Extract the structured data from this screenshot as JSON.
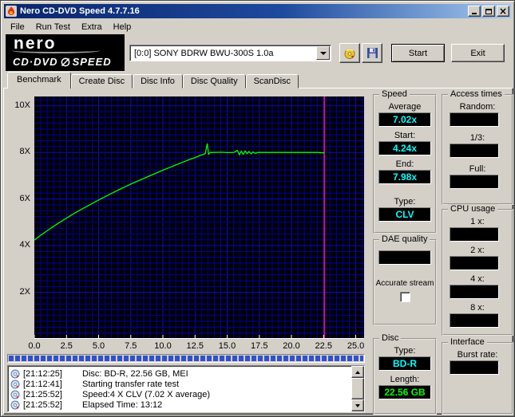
{
  "window": {
    "title": "Nero CD-DVD Speed 4.7.7.16"
  },
  "menu": {
    "items": [
      "File",
      "Run Test",
      "Extra",
      "Help"
    ]
  },
  "logo": {
    "brand": "nero",
    "product_line1": "CD·DVD",
    "product_line2": "SPEED"
  },
  "toolbar": {
    "drive_selector": {
      "value": "[0:0]  SONY BDRW BWU-300S 1.0a"
    },
    "buttons": [
      {
        "icon": "disc-icon"
      },
      {
        "icon": "save-icon"
      }
    ],
    "start_label": "Start",
    "exit_label": "Exit"
  },
  "tabs": [
    {
      "label": "Benchmark",
      "active": true
    },
    {
      "label": "Create Disc"
    },
    {
      "label": "Disc Info"
    },
    {
      "label": "Disc Quality"
    },
    {
      "label": "ScanDisc"
    }
  ],
  "chart_data": {
    "type": "line",
    "xlabel": "",
    "ylabel": "",
    "xlim": [
      0,
      25.65
    ],
    "ylim": [
      0,
      10.4
    ],
    "grid": {
      "x_step": 0.5,
      "y_step": 0.25,
      "x_major": 2.5,
      "y_major": 2
    },
    "x_ticks": [
      {
        "v": 0,
        "label": "0.0"
      },
      {
        "v": 2.5,
        "label": "2.5"
      },
      {
        "v": 5,
        "label": "5.0"
      },
      {
        "v": 7.5,
        "label": "7.5"
      },
      {
        "v": 10,
        "label": "10.0"
      },
      {
        "v": 12.5,
        "label": "12.5"
      },
      {
        "v": 15,
        "label": "15.0"
      },
      {
        "v": 17.5,
        "label": "17.5"
      },
      {
        "v": 20,
        "label": "20.0"
      },
      {
        "v": 22.5,
        "label": "22.5"
      },
      {
        "v": 25,
        "label": "25.0"
      }
    ],
    "y_ticks": [
      {
        "v": 2,
        "label": "2X"
      },
      {
        "v": 4,
        "label": "4X"
      },
      {
        "v": 6,
        "label": "6X"
      },
      {
        "v": 8,
        "label": "8X"
      },
      {
        "v": 10,
        "label": "10X"
      }
    ],
    "series": [
      {
        "name": "transfer-rate",
        "color": "#00ff00",
        "points": [
          [
            0,
            4.24
          ],
          [
            0.5,
            4.45
          ],
          [
            1,
            4.64
          ],
          [
            1.5,
            4.83
          ],
          [
            2,
            5.01
          ],
          [
            2.5,
            5.18
          ],
          [
            3,
            5.35
          ],
          [
            3.5,
            5.51
          ],
          [
            4,
            5.66
          ],
          [
            4.5,
            5.81
          ],
          [
            5,
            5.96
          ],
          [
            5.5,
            6.1
          ],
          [
            6,
            6.24
          ],
          [
            6.5,
            6.38
          ],
          [
            7,
            6.51
          ],
          [
            7.5,
            6.64
          ],
          [
            8,
            6.76
          ],
          [
            8.5,
            6.88
          ],
          [
            9,
            7.0
          ],
          [
            9.5,
            7.12
          ],
          [
            10,
            7.24
          ],
          [
            10.5,
            7.35
          ],
          [
            11,
            7.46
          ],
          [
            11.5,
            7.57
          ],
          [
            12,
            7.68
          ],
          [
            12.5,
            7.78
          ],
          [
            13,
            7.89
          ],
          [
            13.3,
            7.95
          ],
          [
            13.45,
            8.38
          ],
          [
            13.55,
            7.92
          ],
          [
            13.7,
            8.0
          ],
          [
            14,
            8.0
          ],
          [
            14.5,
            8.01
          ],
          [
            15,
            7.99
          ],
          [
            15.5,
            8.0
          ],
          [
            15.8,
            8.08
          ],
          [
            15.95,
            7.9
          ],
          [
            16.1,
            8.05
          ],
          [
            16.25,
            7.92
          ],
          [
            16.4,
            8.06
          ],
          [
            16.55,
            7.95
          ],
          [
            16.7,
            8.04
          ],
          [
            16.85,
            7.94
          ],
          [
            17,
            8.02
          ],
          [
            17.2,
            7.96
          ],
          [
            17.4,
            8.0
          ],
          [
            18,
            8.0
          ],
          [
            19,
            8.0
          ],
          [
            20,
            8.0
          ],
          [
            21,
            8.0
          ],
          [
            22,
            8.0
          ],
          [
            22.56,
            7.98
          ]
        ]
      }
    ],
    "marker_line": {
      "x": 22.56,
      "color": "#ff00aa"
    },
    "stats": {
      "average": "7.02x",
      "start": "4.24x",
      "end": "7.98x",
      "type": "CLV"
    }
  },
  "progress": {
    "percent": 100
  },
  "panels": {
    "speed": {
      "title": "Speed",
      "rows": [
        {
          "label": "Average",
          "value": "7.02x"
        },
        {
          "label": "Start:",
          "value": "4.24x"
        },
        {
          "label": "End:",
          "value": "7.98x"
        },
        {
          "label": "Type:",
          "value": "CLV"
        }
      ]
    },
    "access_times": {
      "title": "Access times",
      "rows": [
        {
          "label": "Random:",
          "value": ""
        },
        {
          "label": "1/3:",
          "value": ""
        },
        {
          "label": "Full:",
          "value": ""
        }
      ]
    },
    "cpu_usage": {
      "title": "CPU usage",
      "rows": [
        {
          "label": "1 x:",
          "value": ""
        },
        {
          "label": "2 x:",
          "value": ""
        },
        {
          "label": "4 x:",
          "value": ""
        },
        {
          "label": "8 x:",
          "value": ""
        }
      ]
    },
    "dae_quality": {
      "title": "DAE quality",
      "value": "",
      "accurate_stream_label": "Accurate stream",
      "accurate_stream_checked": false
    },
    "disc": {
      "title": "Disc",
      "rows": [
        {
          "label": "Type:",
          "value": "BD-R",
          "color": "#00ffff"
        },
        {
          "label": "Length:",
          "value": "22.56 GB",
          "color": "#00ff00"
        }
      ]
    },
    "interface": {
      "title": "Interface",
      "rows": [
        {
          "label": "Burst rate:",
          "value": ""
        }
      ]
    }
  },
  "log": {
    "lines": [
      {
        "time": "[21:12:25]",
        "text": "Disc: BD-R, 22.56 GB, MEI"
      },
      {
        "time": "[21:12:41]",
        "text": "Starting transfer rate test"
      },
      {
        "time": "[21:25:52]",
        "text": "Speed:4 X CLV (7.02 X average)"
      },
      {
        "time": "[21:25:52]",
        "text": "Elapsed Time: 13:12"
      }
    ]
  },
  "colors": {
    "window_bg": "#d4d0c8",
    "titlebar_start": "#0a246a",
    "titlebar_end": "#a6caf0",
    "chart_bg": "#000000",
    "grid": "#0000a0",
    "curve": "#00ff00",
    "marker": "#ff00aa",
    "value_text": "#00ffff",
    "length_text": "#00ff00",
    "progress_segment": "#3050d0"
  }
}
